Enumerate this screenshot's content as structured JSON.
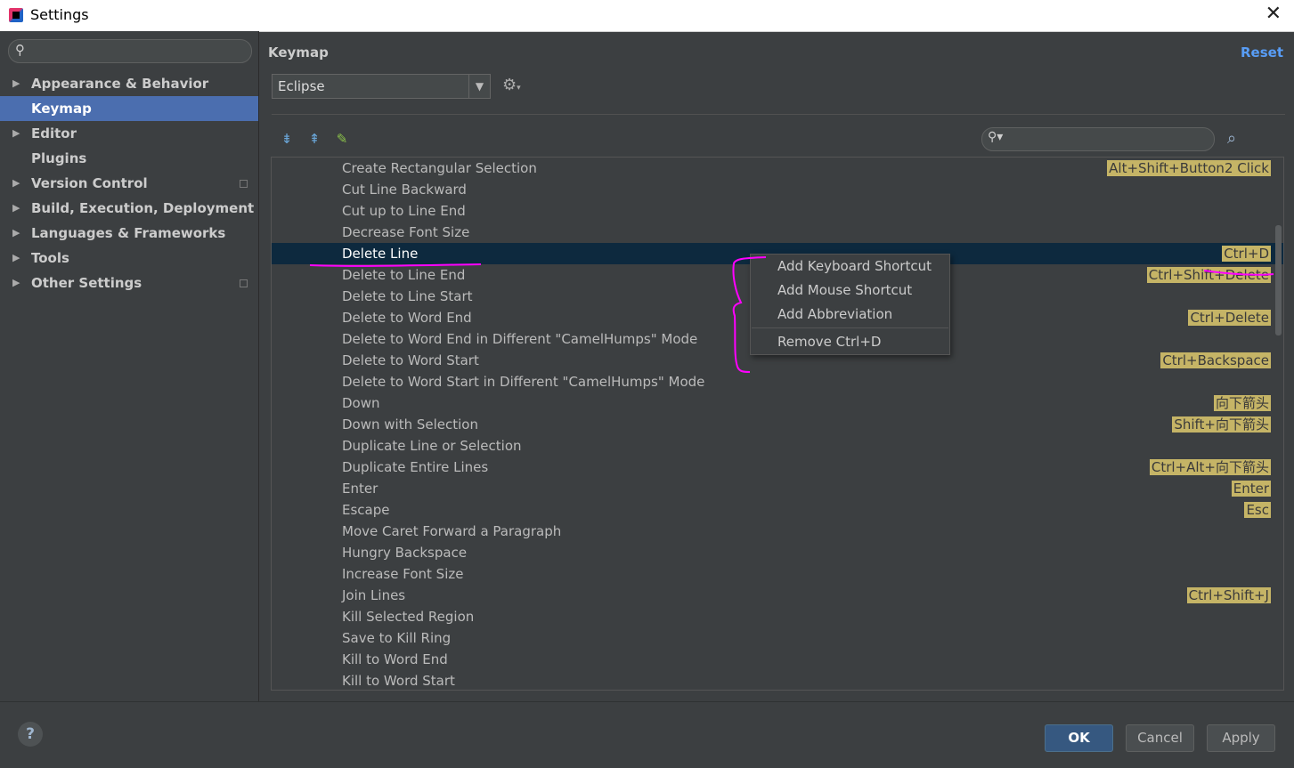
{
  "window": {
    "title": "Settings"
  },
  "sidebar": {
    "items": [
      {
        "label": "Appearance & Behavior"
      },
      {
        "label": "Keymap"
      },
      {
        "label": "Editor"
      },
      {
        "label": "Plugins"
      },
      {
        "label": "Version Control"
      },
      {
        "label": "Build, Execution, Deployment"
      },
      {
        "label": "Languages & Frameworks"
      },
      {
        "label": "Tools"
      },
      {
        "label": "Other Settings"
      }
    ],
    "selected": "Keymap"
  },
  "main": {
    "title": "Keymap",
    "reset_label": "Reset",
    "keymap_selected": "Eclipse"
  },
  "actions": [
    {
      "name": "Create Rectangular Selection",
      "shortcut": "Alt+Shift+Button2 Click"
    },
    {
      "name": "Cut Line Backward",
      "shortcut": ""
    },
    {
      "name": "Cut up to Line End",
      "shortcut": ""
    },
    {
      "name": "Decrease Font Size",
      "shortcut": ""
    },
    {
      "name": "Delete Line",
      "shortcut": "Ctrl+D"
    },
    {
      "name": "Delete to Line End",
      "shortcut": "Ctrl+Shift+Delete"
    },
    {
      "name": "Delete to Line Start",
      "shortcut": ""
    },
    {
      "name": "Delete to Word End",
      "shortcut": "Ctrl+Delete"
    },
    {
      "name": "Delete to Word End in Different \"CamelHumps\" Mode",
      "shortcut": ""
    },
    {
      "name": "Delete to Word Start",
      "shortcut": "Ctrl+Backspace"
    },
    {
      "name": "Delete to Word Start in Different \"CamelHumps\" Mode",
      "shortcut": ""
    },
    {
      "name": "Down",
      "shortcut": "向下箭头"
    },
    {
      "name": "Down with Selection",
      "shortcut": "Shift+向下箭头"
    },
    {
      "name": "Duplicate Line or Selection",
      "shortcut": ""
    },
    {
      "name": "Duplicate Entire Lines",
      "shortcut": "Ctrl+Alt+向下箭头"
    },
    {
      "name": "Enter",
      "shortcut": "Enter"
    },
    {
      "name": "Escape",
      "shortcut": "Esc"
    },
    {
      "name": "Move Caret Forward a Paragraph",
      "shortcut": ""
    },
    {
      "name": "Hungry Backspace",
      "shortcut": ""
    },
    {
      "name": "Increase Font Size",
      "shortcut": ""
    },
    {
      "name": "Join Lines",
      "shortcut": "Ctrl+Shift+J"
    },
    {
      "name": "Kill Selected Region",
      "shortcut": ""
    },
    {
      "name": "Save to Kill Ring",
      "shortcut": ""
    },
    {
      "name": "Kill to Word End",
      "shortcut": ""
    },
    {
      "name": "Kill to Word Start",
      "shortcut": ""
    }
  ],
  "selected_action": "Delete Line",
  "context_menu": {
    "items": [
      {
        "label": "Add Keyboard Shortcut"
      },
      {
        "label": "Add Mouse Shortcut"
      },
      {
        "label": "Add Abbreviation"
      },
      {
        "label": "Remove Ctrl+D"
      }
    ]
  },
  "footer": {
    "help_label": "?",
    "ok_label": "OK",
    "cancel_label": "Cancel",
    "apply_label": "Apply"
  },
  "colors": {
    "background": "#3c3f41",
    "selection": "#4b6eaf",
    "row_selection": "#0d293e",
    "shortcut_highlight": "#c5b466",
    "link": "#589df6",
    "annotation": "#ff00ff"
  },
  "icons": [
    "app-icon",
    "close-icon",
    "search-icon",
    "expand-arrow-icon",
    "chevron-down-icon",
    "gear-icon",
    "expand-all-icon",
    "collapse-all-icon",
    "edit-icon",
    "find-by-shortcut-icon",
    "help-icon",
    "project-scope-icon"
  ]
}
